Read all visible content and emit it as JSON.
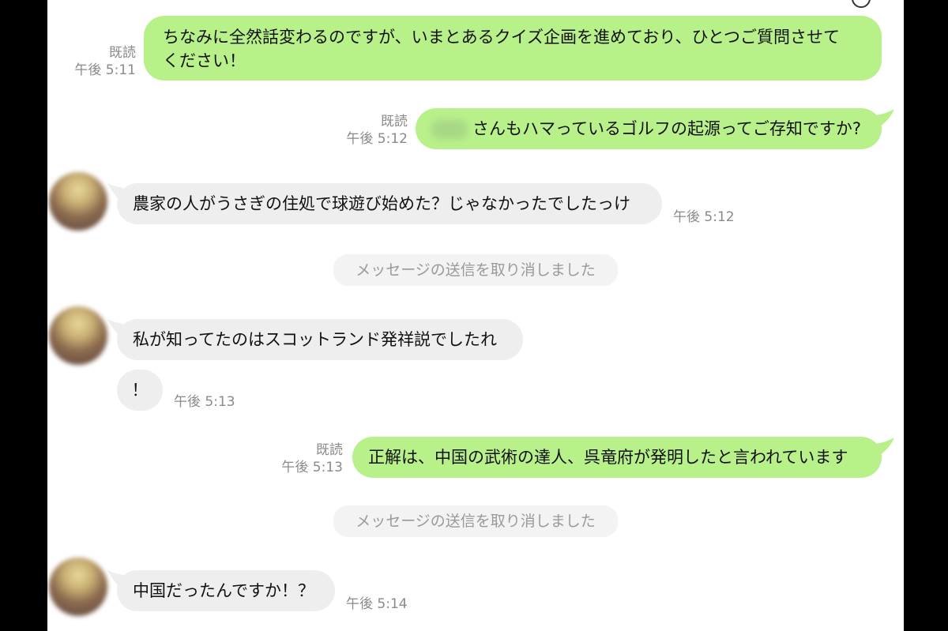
{
  "messages": [
    {
      "dir": "out",
      "read": "既読",
      "time": "午後 5:11",
      "text_lines": [
        "ちなみに全然話変わるのですが、いまとあるクイズ企画を進めており、ひとつご質問させて",
        "ください！"
      ]
    },
    {
      "dir": "out",
      "read": "既読",
      "time": "午後 5:12",
      "text": "さんもハマっているゴルフの起源ってご存知ですか?"
    },
    {
      "dir": "in",
      "time": "午後 5:12",
      "text": "農家の人がうさぎの住処で球遊び始めた？じゃなかったでしたっけ"
    },
    {
      "notice": "メッセージの送信を取り消しました"
    },
    {
      "dir": "in",
      "text": "私が知ってたのはスコットランド発祥説でしたれ"
    },
    {
      "dir": "in",
      "time": "午後 5:13",
      "text": "！"
    },
    {
      "dir": "out",
      "read": "既読",
      "time": "午後 5:13",
      "text": "正解は、中国の武術の達人、呉竜府が発明したと言われています"
    },
    {
      "notice": "メッセージの送信を取り消しました"
    },
    {
      "dir": "in",
      "time": "午後 5:14",
      "text": "中国だったんですか！？"
    }
  ],
  "colors": {
    "outgoing": "#b8f08a",
    "incoming": "#eeeeee",
    "notice_bg": "#f3f3f3",
    "meta": "#8a8a8a",
    "frame": "#000000"
  }
}
